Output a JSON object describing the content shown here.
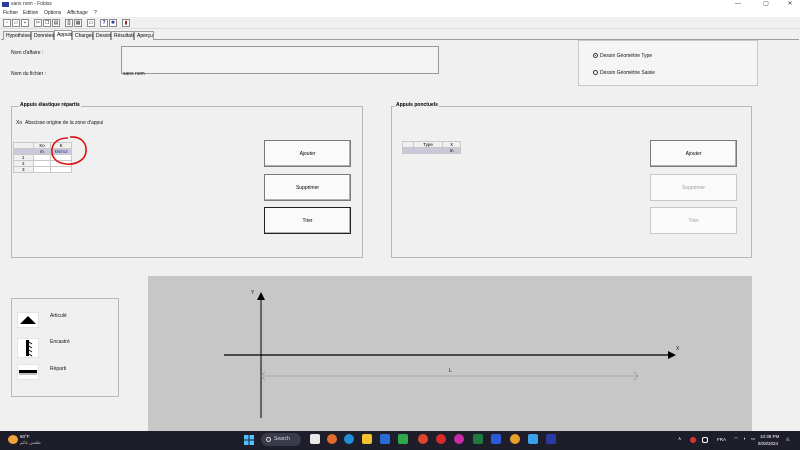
{
  "window": {
    "title": "sans nom - Fobiss",
    "controls": {
      "minimize": "—",
      "maximize": "▢",
      "close": "✕"
    }
  },
  "menu": [
    "Fichier",
    "Edition",
    "Options",
    "Affichage",
    "?"
  ],
  "toolbar": {
    "icons": [
      "new-icon",
      "open-icon",
      "save-icon",
      "cut-icon",
      "copy-icon",
      "paste-icon",
      "print-icon",
      "preview-icon",
      "help-icon",
      "settings-icon",
      "book-icon"
    ],
    "help_glyph": "?"
  },
  "tabs": [
    {
      "label": "Hypothèses",
      "active": false
    },
    {
      "label": "Données",
      "active": false
    },
    {
      "label": "Appuis",
      "active": true
    },
    {
      "label": "Charges",
      "active": false
    },
    {
      "label": "Dessin",
      "active": false
    },
    {
      "label": "Résultats",
      "active": false
    },
    {
      "label": "Aperçu",
      "active": false
    }
  ],
  "header": {
    "name_label": "Nom d'affaire :",
    "name_value": "",
    "file_label": "Nom du fichier :",
    "file_value": "sans nom"
  },
  "drawing_options": {
    "options": [
      {
        "label": "Dessin Géométrie Type",
        "selected": true
      },
      {
        "label": "Dessin Géométrie Saisie",
        "selected": false
      }
    ]
  },
  "elastic_supports": {
    "title": "Appuis élastique répartis",
    "hint_key": "Xo",
    "hint_text": "Abscisse origine de la zone d'appui",
    "columns": [
      "Xo",
      "K"
    ],
    "units": [
      "m",
      "kN/m2"
    ],
    "rows": [
      {
        "index": "1",
        "xo": "",
        "k": ""
      },
      {
        "index": "2",
        "xo": "",
        "k": ""
      },
      {
        "index": "3",
        "xo": "",
        "k": ""
      }
    ],
    "buttons": {
      "add": "Ajouter",
      "delete": "Supprimer",
      "sort": "Trier"
    }
  },
  "point_supports": {
    "title": "Appuis ponctuels",
    "columns": [
      "Type",
      "X"
    ],
    "units": [
      "",
      "m"
    ],
    "buttons": {
      "add": "Ajouter",
      "delete": "Supprimer",
      "sort": "Trier"
    }
  },
  "legend": {
    "items": [
      {
        "label": "Articulé",
        "icon": "hinge-support-icon"
      },
      {
        "label": "Encastré",
        "icon": "fixed-support-icon"
      },
      {
        "label": "Réparti",
        "icon": "distributed-support-icon"
      }
    ]
  },
  "canvas": {
    "axis_y": "Y",
    "axis_x": "X",
    "length_label": "L"
  },
  "taskbar": {
    "weather_temp": "60°F",
    "weather_text": "طقس غائم",
    "search_label": "Search",
    "language": "FRA",
    "time": "10:38 PM",
    "date": "9/28/2024"
  }
}
